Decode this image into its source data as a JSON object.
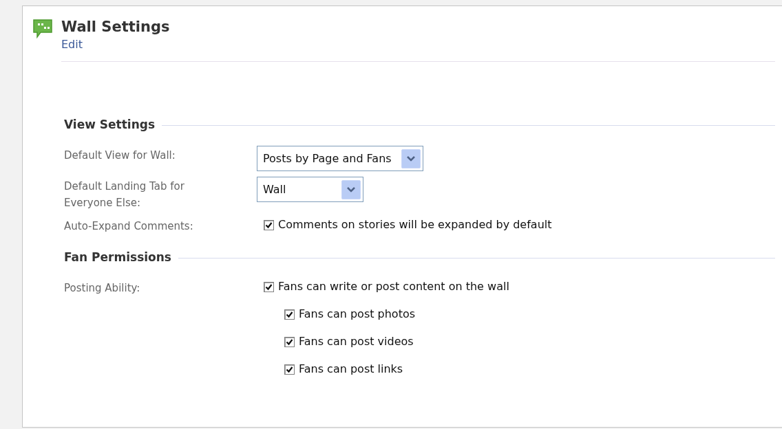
{
  "title": "Wall Settings",
  "edit_link": "Edit",
  "sections": [
    {
      "heading": "View Settings",
      "rows": [
        {
          "kind": "select",
          "label": "Default View for Wall:",
          "value": "Posts by Page and Fans"
        },
        {
          "kind": "select",
          "label": "Default Landing Tab for Everyone Else:",
          "value": "Wall"
        },
        {
          "kind": "checkbox",
          "label": "Auto-Expand Comments:",
          "options": [
            {
              "text": "Comments on stories will be expanded by default",
              "checked": true
            }
          ]
        }
      ]
    },
    {
      "heading": "Fan Permissions",
      "rows": [
        {
          "kind": "checkbox",
          "label": "Posting Ability:",
          "options": [
            {
              "text": "Fans can write or post content on the wall",
              "checked": true,
              "children": [
                {
                  "text": "Fans can post photos",
                  "checked": true
                },
                {
                  "text": "Fans can post videos",
                  "checked": true
                },
                {
                  "text": "Fans can post links",
                  "checked": true
                }
              ]
            }
          ]
        }
      ]
    }
  ]
}
